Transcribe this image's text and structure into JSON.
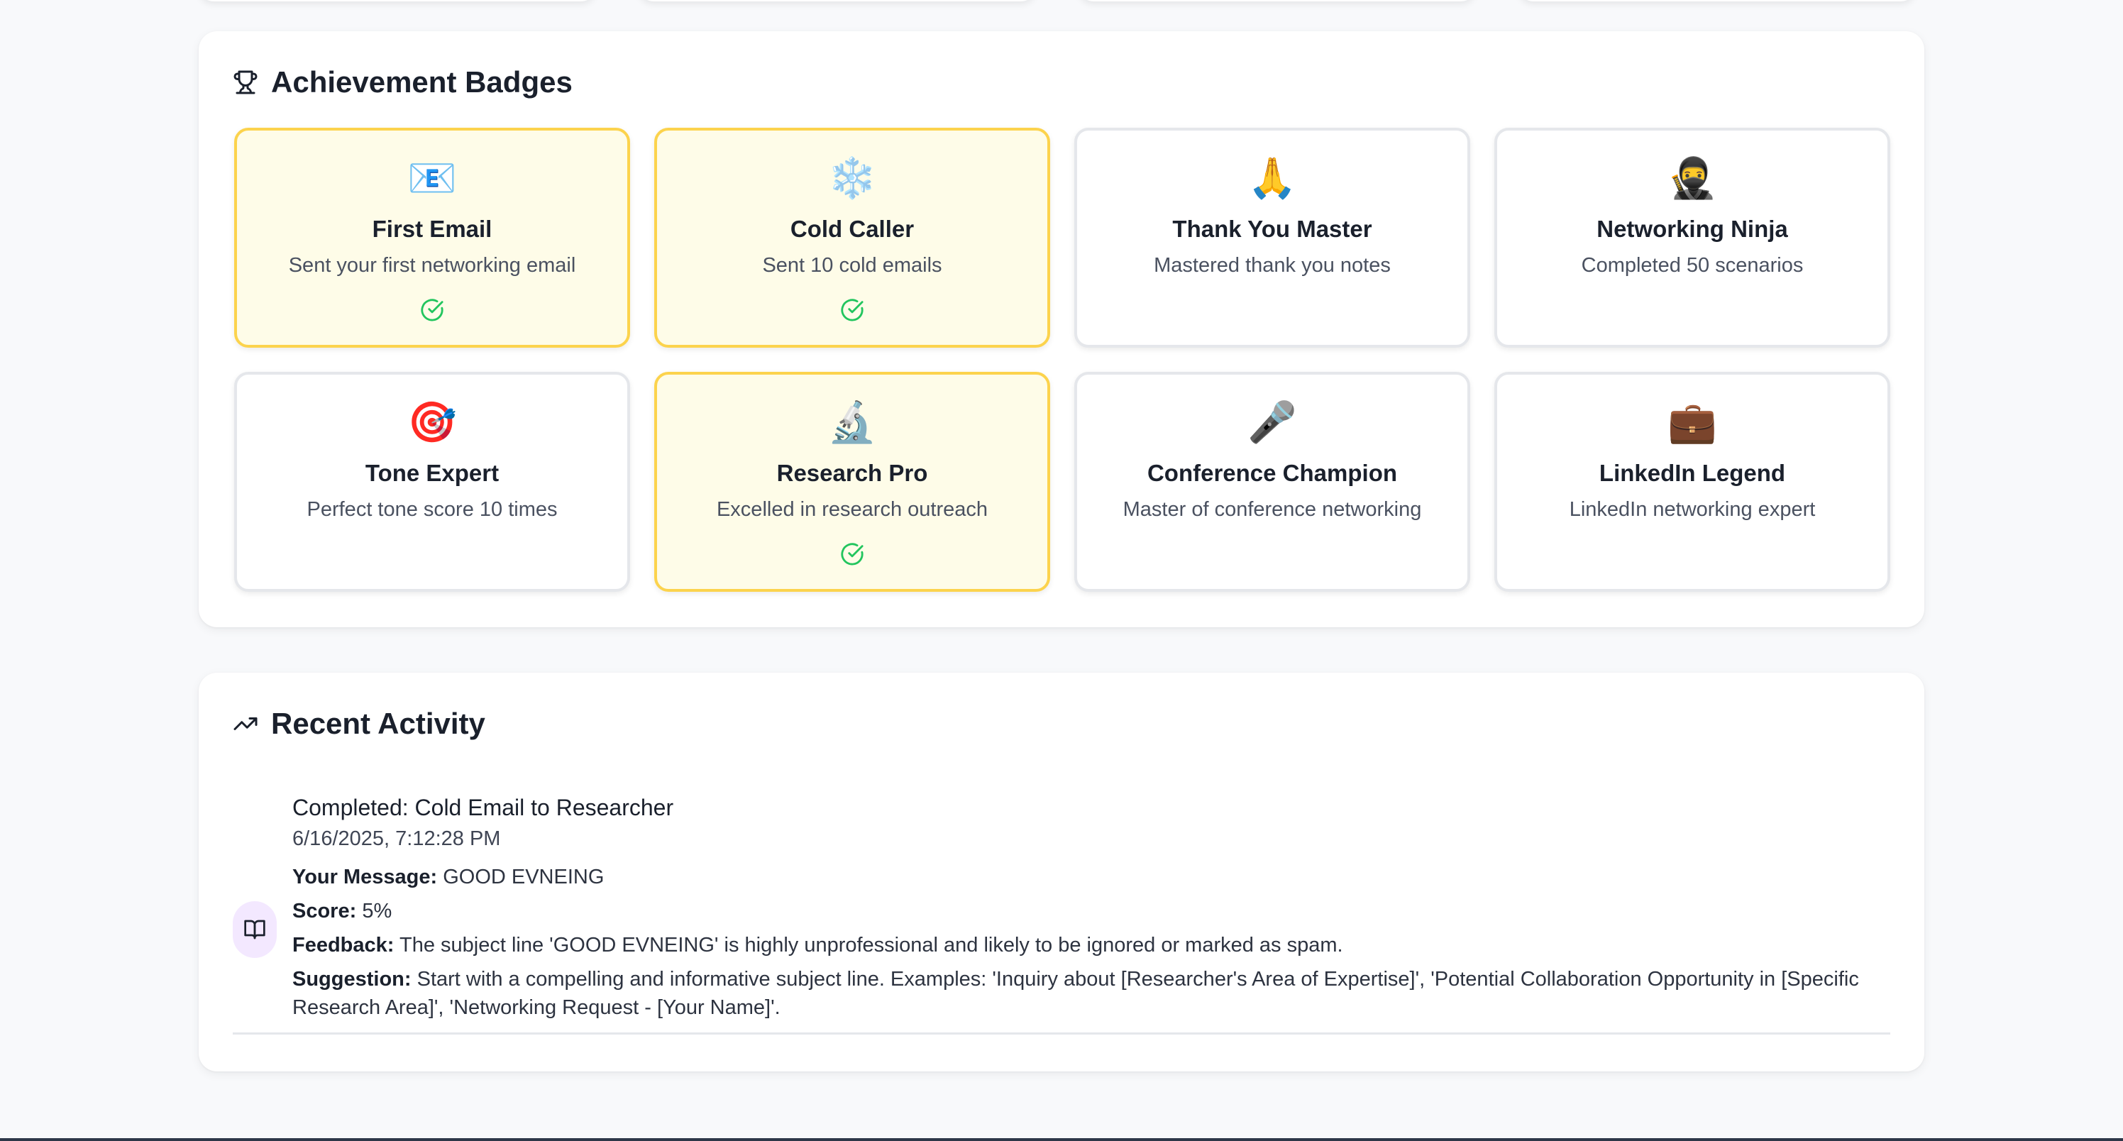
{
  "badges_section": {
    "title": "Achievement Badges",
    "title_icon": "trophy-icon",
    "badges": [
      {
        "emoji": "📧",
        "name": "First Email",
        "description": "Sent your first networking email",
        "earned": true
      },
      {
        "emoji": "❄️",
        "name": "Cold Caller",
        "description": "Sent 10 cold emails",
        "earned": true
      },
      {
        "emoji": "🙏",
        "name": "Thank You Master",
        "description": "Mastered thank you notes",
        "earned": false
      },
      {
        "emoji": "🥷",
        "name": "Networking Ninja",
        "description": "Completed 50 scenarios",
        "earned": false
      },
      {
        "emoji": "🎯",
        "name": "Tone Expert",
        "description": "Perfect tone score 10 times",
        "earned": false
      },
      {
        "emoji": "🔬",
        "name": "Research Pro",
        "description": "Excelled in research outreach",
        "earned": true
      },
      {
        "emoji": "🎤",
        "name": "Conference Champion",
        "description": "Master of conference networking",
        "earned": false
      },
      {
        "emoji": "💼",
        "name": "LinkedIn Legend",
        "description": "LinkedIn networking expert",
        "earned": false
      }
    ]
  },
  "activity_section": {
    "title": "Recent Activity",
    "title_icon": "trending-up-icon",
    "items": [
      {
        "icon": "book-open-icon",
        "title": "Completed: Cold Email to Researcher",
        "timestamp": "6/16/2025, 7:12:28 PM",
        "message_label": "Your Message:",
        "message": "GOOD EVNEING",
        "score_label": "Score:",
        "score": "5%",
        "feedback_label": "Feedback:",
        "feedback": "The subject line 'GOOD EVNEING' is highly unprofessional and likely to be ignored or marked as spam.",
        "suggestion_label": "Suggestion:",
        "suggestion": "Start with a compelling and informative subject line. Examples: 'Inquiry about [Researcher's Area of Expertise]', 'Potential Collaboration Opportunity in [Specific Research Area]', 'Networking Request - [Your Name]'."
      }
    ]
  },
  "colors": {
    "earned_border": "#fcd34d",
    "earned_background": "#fefce8",
    "check_green": "#22c55e",
    "activity_icon_bg": "#f3e8ff"
  }
}
